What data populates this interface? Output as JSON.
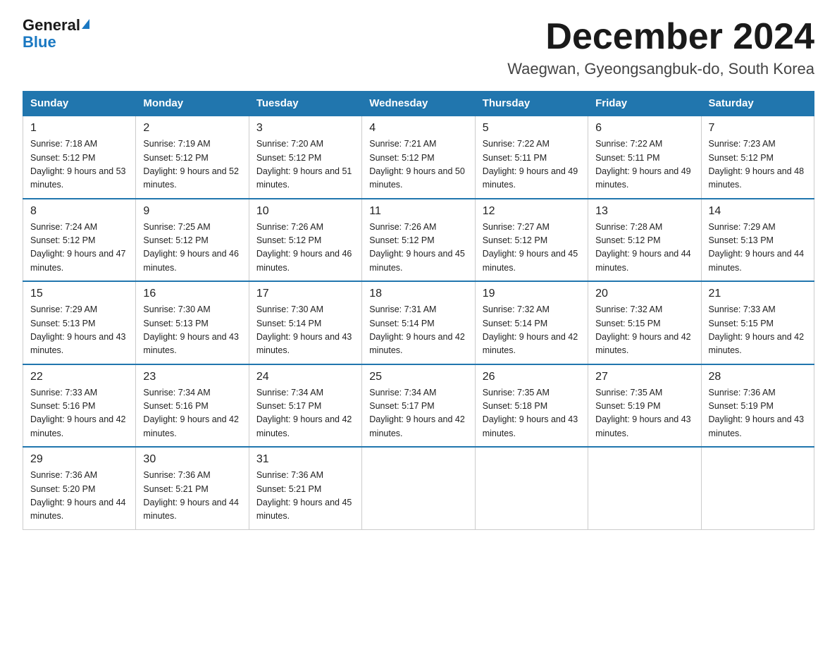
{
  "header": {
    "logo_general": "General",
    "logo_blue": "Blue",
    "month_title": "December 2024",
    "location": "Waegwan, Gyeongsangbuk-do, South Korea"
  },
  "weekdays": [
    "Sunday",
    "Monday",
    "Tuesday",
    "Wednesday",
    "Thursday",
    "Friday",
    "Saturday"
  ],
  "weeks": [
    [
      {
        "day": 1,
        "sunrise": "7:18 AM",
        "sunset": "5:12 PM",
        "daylight": "9 hours and 53 minutes."
      },
      {
        "day": 2,
        "sunrise": "7:19 AM",
        "sunset": "5:12 PM",
        "daylight": "9 hours and 52 minutes."
      },
      {
        "day": 3,
        "sunrise": "7:20 AM",
        "sunset": "5:12 PM",
        "daylight": "9 hours and 51 minutes."
      },
      {
        "day": 4,
        "sunrise": "7:21 AM",
        "sunset": "5:12 PM",
        "daylight": "9 hours and 50 minutes."
      },
      {
        "day": 5,
        "sunrise": "7:22 AM",
        "sunset": "5:11 PM",
        "daylight": "9 hours and 49 minutes."
      },
      {
        "day": 6,
        "sunrise": "7:22 AM",
        "sunset": "5:11 PM",
        "daylight": "9 hours and 49 minutes."
      },
      {
        "day": 7,
        "sunrise": "7:23 AM",
        "sunset": "5:12 PM",
        "daylight": "9 hours and 48 minutes."
      }
    ],
    [
      {
        "day": 8,
        "sunrise": "7:24 AM",
        "sunset": "5:12 PM",
        "daylight": "9 hours and 47 minutes."
      },
      {
        "day": 9,
        "sunrise": "7:25 AM",
        "sunset": "5:12 PM",
        "daylight": "9 hours and 46 minutes."
      },
      {
        "day": 10,
        "sunrise": "7:26 AM",
        "sunset": "5:12 PM",
        "daylight": "9 hours and 46 minutes."
      },
      {
        "day": 11,
        "sunrise": "7:26 AM",
        "sunset": "5:12 PM",
        "daylight": "9 hours and 45 minutes."
      },
      {
        "day": 12,
        "sunrise": "7:27 AM",
        "sunset": "5:12 PM",
        "daylight": "9 hours and 45 minutes."
      },
      {
        "day": 13,
        "sunrise": "7:28 AM",
        "sunset": "5:12 PM",
        "daylight": "9 hours and 44 minutes."
      },
      {
        "day": 14,
        "sunrise": "7:29 AM",
        "sunset": "5:13 PM",
        "daylight": "9 hours and 44 minutes."
      }
    ],
    [
      {
        "day": 15,
        "sunrise": "7:29 AM",
        "sunset": "5:13 PM",
        "daylight": "9 hours and 43 minutes."
      },
      {
        "day": 16,
        "sunrise": "7:30 AM",
        "sunset": "5:13 PM",
        "daylight": "9 hours and 43 minutes."
      },
      {
        "day": 17,
        "sunrise": "7:30 AM",
        "sunset": "5:14 PM",
        "daylight": "9 hours and 43 minutes."
      },
      {
        "day": 18,
        "sunrise": "7:31 AM",
        "sunset": "5:14 PM",
        "daylight": "9 hours and 42 minutes."
      },
      {
        "day": 19,
        "sunrise": "7:32 AM",
        "sunset": "5:14 PM",
        "daylight": "9 hours and 42 minutes."
      },
      {
        "day": 20,
        "sunrise": "7:32 AM",
        "sunset": "5:15 PM",
        "daylight": "9 hours and 42 minutes."
      },
      {
        "day": 21,
        "sunrise": "7:33 AM",
        "sunset": "5:15 PM",
        "daylight": "9 hours and 42 minutes."
      }
    ],
    [
      {
        "day": 22,
        "sunrise": "7:33 AM",
        "sunset": "5:16 PM",
        "daylight": "9 hours and 42 minutes."
      },
      {
        "day": 23,
        "sunrise": "7:34 AM",
        "sunset": "5:16 PM",
        "daylight": "9 hours and 42 minutes."
      },
      {
        "day": 24,
        "sunrise": "7:34 AM",
        "sunset": "5:17 PM",
        "daylight": "9 hours and 42 minutes."
      },
      {
        "day": 25,
        "sunrise": "7:34 AM",
        "sunset": "5:17 PM",
        "daylight": "9 hours and 42 minutes."
      },
      {
        "day": 26,
        "sunrise": "7:35 AM",
        "sunset": "5:18 PM",
        "daylight": "9 hours and 43 minutes."
      },
      {
        "day": 27,
        "sunrise": "7:35 AM",
        "sunset": "5:19 PM",
        "daylight": "9 hours and 43 minutes."
      },
      {
        "day": 28,
        "sunrise": "7:36 AM",
        "sunset": "5:19 PM",
        "daylight": "9 hours and 43 minutes."
      }
    ],
    [
      {
        "day": 29,
        "sunrise": "7:36 AM",
        "sunset": "5:20 PM",
        "daylight": "9 hours and 44 minutes."
      },
      {
        "day": 30,
        "sunrise": "7:36 AM",
        "sunset": "5:21 PM",
        "daylight": "9 hours and 44 minutes."
      },
      {
        "day": 31,
        "sunrise": "7:36 AM",
        "sunset": "5:21 PM",
        "daylight": "9 hours and 45 minutes."
      },
      null,
      null,
      null,
      null
    ]
  ]
}
